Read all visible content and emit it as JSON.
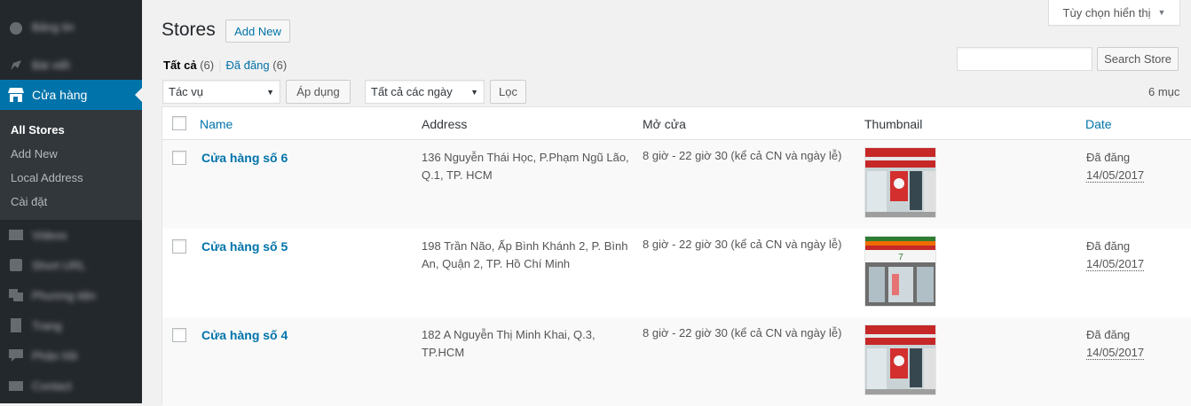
{
  "sidebar": {
    "items": [
      {
        "label": "Bảng tin",
        "icon": "dashboard-icon"
      },
      {
        "label": "Bài viết",
        "icon": "pin-icon"
      },
      {
        "label": "Cửa hàng",
        "icon": "store-icon",
        "current": true
      },
      {
        "label": "Videos",
        "icon": "video-icon"
      },
      {
        "label": "Short URL",
        "icon": "link-icon"
      },
      {
        "label": "Phương tiện",
        "icon": "media-icon"
      },
      {
        "label": "Trang",
        "icon": "page-icon"
      },
      {
        "label": "Phản hồi",
        "icon": "comment-icon"
      },
      {
        "label": "Contact",
        "icon": "mail-icon"
      }
    ],
    "submenu": [
      "All Stores",
      "Add New",
      "Local Address",
      "Cài đặt"
    ]
  },
  "screen_options": {
    "label": "Tùy chọn hiển thị"
  },
  "header": {
    "title": "Stores",
    "add_new": "Add New"
  },
  "filters": {
    "all_label": "Tất cả",
    "all_count": "(6)",
    "published_label": "Đã đăng",
    "published_count": "(6)",
    "bulk_action": "Tác vụ",
    "apply": "Áp dụng",
    "date_filter": "Tất cả các ngày",
    "filter_btn": "Lọc",
    "items_count": "6 mục",
    "search_value": "",
    "search_btn": "Search Store"
  },
  "table": {
    "columns": [
      "Name",
      "Address",
      "Mở cửa",
      "Thumbnail",
      "Date"
    ],
    "rows": [
      {
        "name": "Cửa hàng số 6",
        "address": "136 Nguyễn Thái Học, P.Phạm Ngũ Lão, Q.1, TP. HCM",
        "hours": "8 giờ - 22 giờ 30 (kể cả CN và ngày lễ)",
        "status": "Đã đăng",
        "date": "14/05/2017"
      },
      {
        "name": "Cửa hàng số 5",
        "address": "198 Trần Não, Ấp Bình Khánh 2, P. Bình An, Quận 2, TP. Hồ Chí Minh",
        "hours": "8 giờ - 22 giờ 30 (kể cả CN và ngày lễ)",
        "status": "Đã đăng",
        "date": "14/05/2017"
      },
      {
        "name": "Cửa hàng số 4",
        "address": "182 A Nguyễn Thị Minh Khai, Q.3, TP.HCM",
        "hours": "8 giờ - 22 giờ 30 (kể cả CN và ngày lễ)",
        "status": "Đã đăng",
        "date": "14/05/2017"
      }
    ]
  },
  "colors": {
    "sidebar_bg": "#23282d",
    "submenu_bg": "#32373c",
    "accent": "#0073aa",
    "page_bg": "#f1f1f1"
  }
}
